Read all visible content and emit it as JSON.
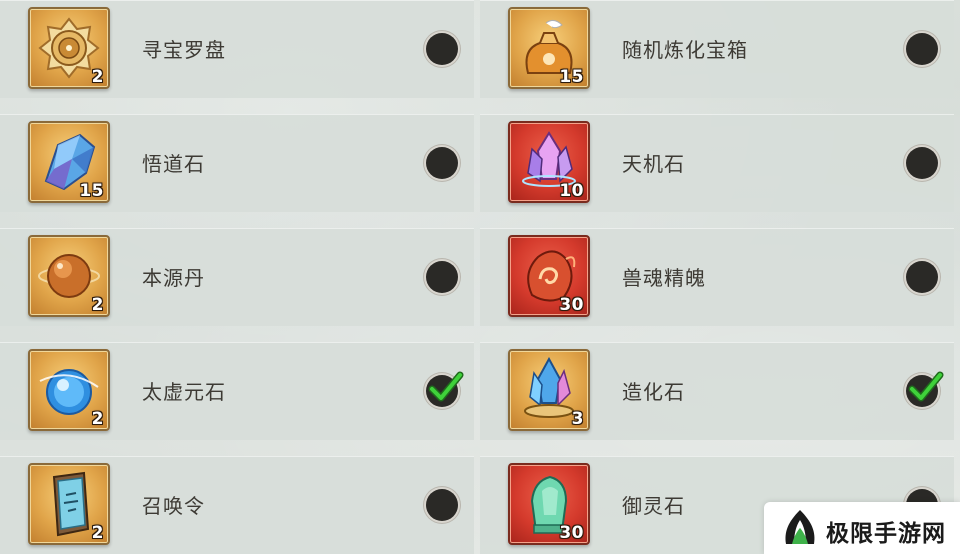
{
  "left_column": [
    {
      "name": "寻宝罗盘",
      "count": "2",
      "frame": "gold",
      "art": "compass-icon",
      "checked": false
    },
    {
      "name": "悟道石",
      "count": "15",
      "frame": "gold",
      "art": "blue-crystal-icon",
      "checked": false
    },
    {
      "name": "本源丹",
      "count": "2",
      "frame": "gold",
      "art": "amber-pill-icon",
      "checked": false
    },
    {
      "name": "太虚元石",
      "count": "2",
      "frame": "gold",
      "art": "azure-orb-icon",
      "checked": true
    },
    {
      "name": "召唤令",
      "count": "2",
      "frame": "gold",
      "art": "summon-token-icon",
      "checked": false
    }
  ],
  "right_column": [
    {
      "name": "随机炼化宝箱",
      "count": "15",
      "frame": "gold",
      "art": "refine-treasure-bag-icon",
      "checked": false
    },
    {
      "name": "天机石",
      "count": "10",
      "frame": "red",
      "art": "pink-crystal-icon",
      "checked": false
    },
    {
      "name": "兽魂精魄",
      "count": "30",
      "frame": "red",
      "art": "beast-soul-icon",
      "checked": false
    },
    {
      "name": "造化石",
      "count": "3",
      "frame": "gold",
      "art": "creation-crystal-icon",
      "checked": true
    },
    {
      "name": "御灵石",
      "count": "30",
      "frame": "red",
      "art": "jade-stone-icon",
      "checked": false
    }
  ],
  "colors": {
    "check_green": "#3fd13a",
    "toggle_dark": "#2a2926",
    "gold_frame": "#e0a449",
    "red_frame": "#d43a2c"
  },
  "watermark": {
    "text": "极限手游网",
    "icon": "jixian-logo-icon"
  }
}
